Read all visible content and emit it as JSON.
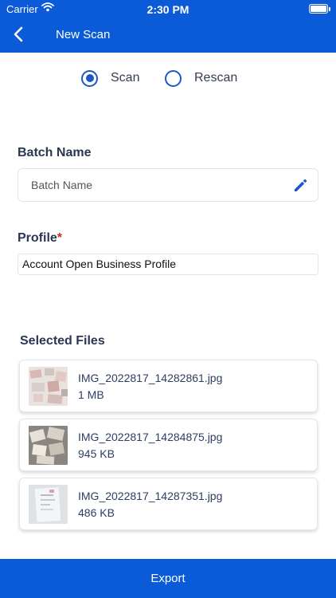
{
  "status_bar": {
    "carrier": "Carrier",
    "time": "2:30 PM"
  },
  "header": {
    "title": "New Scan",
    "back_icon": "chevron-left-icon"
  },
  "scan_mode": {
    "options": [
      {
        "label": "Scan",
        "selected": true
      },
      {
        "label": "Rescan",
        "selected": false
      }
    ]
  },
  "batch": {
    "label": "Batch Name",
    "placeholder": "Batch Name",
    "value": "",
    "edit_icon": "pencil-icon"
  },
  "profile": {
    "label": "Profile",
    "required_mark": "*",
    "value": "Account Open Business Profile"
  },
  "files": {
    "label": "Selected Files",
    "items": [
      {
        "name": "IMG_2022817_14282861.jpg",
        "size": "1 MB"
      },
      {
        "name": "IMG_2022817_14284875.jpg",
        "size": "945 KB"
      },
      {
        "name": "IMG_2022817_14287351.jpg",
        "size": "486 KB"
      }
    ]
  },
  "footer": {
    "export_label": "Export"
  },
  "colors": {
    "primary": "#0b5bd8",
    "radio": "#1a57c9",
    "required": "#c0302a",
    "text_dark": "#2b3651"
  }
}
